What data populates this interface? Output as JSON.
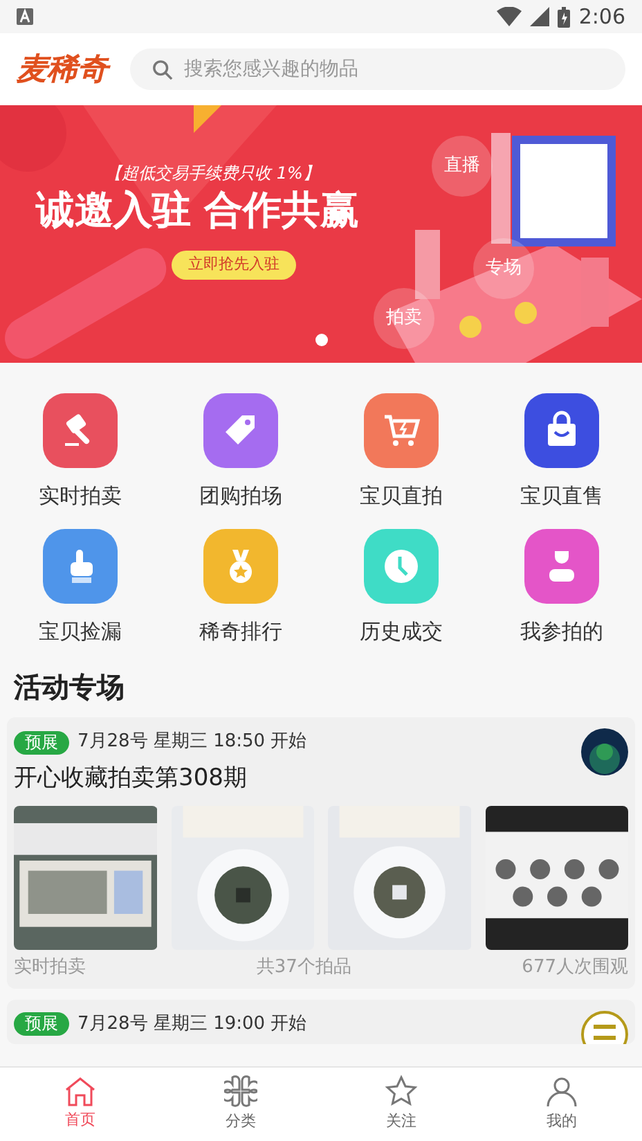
{
  "status_bar": {
    "time": "2:06"
  },
  "header": {
    "logo": "麦稀奇",
    "search": {
      "placeholder": "搜索您感兴趣的物品"
    }
  },
  "banner": {
    "promo": "【超低交易手续费只收 1%】",
    "headline": "诚邀入驻 合作共赢",
    "button": "立即抢先入驻",
    "bubbles": [
      "直播",
      "专场",
      "拍卖"
    ],
    "dots": [
      {
        "selected": true
      }
    ]
  },
  "shortcuts": [
    {
      "label": "实时拍卖",
      "kind": "gavel",
      "color": "#e8505e"
    },
    {
      "label": "团购拍场",
      "kind": "tag",
      "color": "#a56cf0"
    },
    {
      "label": "宝贝直拍",
      "kind": "cart",
      "color": "#f2785a"
    },
    {
      "label": "宝贝直售",
      "kind": "bag",
      "color": "#3d4ee0"
    },
    {
      "label": "宝贝捡漏",
      "kind": "hand",
      "color": "#4f95ea"
    },
    {
      "label": "稀奇排行",
      "kind": "medal",
      "color": "#f2b72e"
    },
    {
      "label": "历史成交",
      "kind": "clock",
      "color": "#3fdcc6"
    },
    {
      "label": "我参拍的",
      "kind": "person",
      "color": "#e455c8"
    }
  ],
  "section_title": "活动专场",
  "events": [
    {
      "badge": "预展",
      "time": "7月28号 星期三 18:50 开始",
      "title": "开心收藏拍卖第308期",
      "type": "实时拍卖",
      "count": "共37个拍品",
      "views": "677人次围观"
    },
    {
      "badge": "预展",
      "time": "7月28号 星期三 19:00 开始"
    }
  ],
  "tabs": [
    {
      "label": "首页",
      "selected": true
    },
    {
      "label": "分类",
      "selected": false
    },
    {
      "label": "关注",
      "selected": false
    },
    {
      "label": "我的",
      "selected": false
    }
  ]
}
